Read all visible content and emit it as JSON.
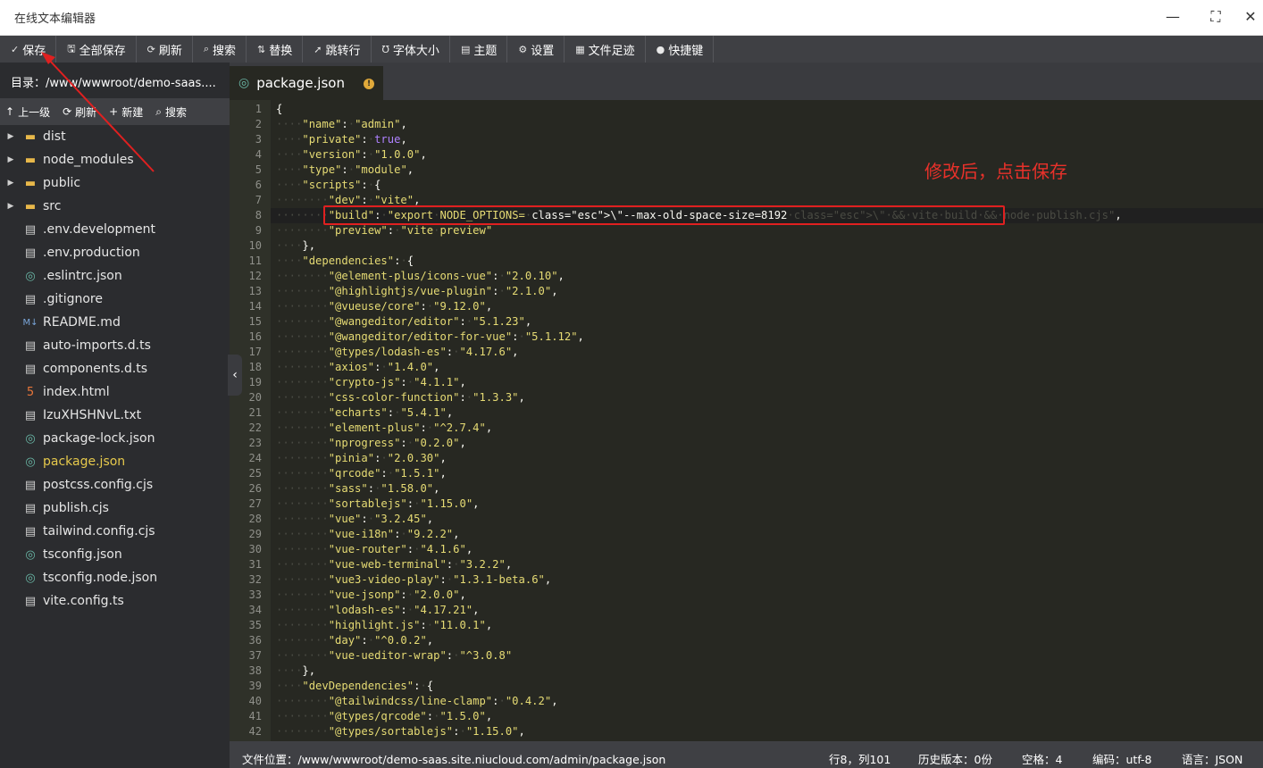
{
  "window": {
    "title": "在线文本编辑器",
    "minimize_icon": "minimize-icon",
    "maximize_icon": "maximize-icon",
    "close_icon": "close-icon"
  },
  "toolbar": {
    "items": [
      {
        "label": "保存",
        "icon": "✓",
        "name": "save"
      },
      {
        "label": "全部保存",
        "icon": "🖫",
        "name": "save-all"
      },
      {
        "label": "刷新",
        "icon": "⟳",
        "name": "refresh"
      },
      {
        "label": "搜索",
        "icon": "⌕",
        "name": "search"
      },
      {
        "label": "替换",
        "icon": "⇅",
        "name": "replace"
      },
      {
        "label": "跳转行",
        "icon": "➚",
        "name": "goto-line"
      },
      {
        "label": "字体大小",
        "icon": "Ʊ",
        "name": "font-size"
      },
      {
        "label": "主题",
        "icon": "▤",
        "name": "theme"
      },
      {
        "label": "设置",
        "icon": "⚙",
        "name": "settings"
      },
      {
        "label": "文件足迹",
        "icon": "▦",
        "name": "file-history"
      },
      {
        "label": "快捷键",
        "icon": "●",
        "name": "shortcuts"
      }
    ]
  },
  "sidebar": {
    "directory": "目录：/www/wwwroot/demo-saas....",
    "actions": [
      {
        "label": "上一级",
        "icon": "↑",
        "name": "parent"
      },
      {
        "label": "刷新",
        "icon": "⟳",
        "name": "refresh"
      },
      {
        "label": "新建",
        "icon": "+",
        "name": "new"
      },
      {
        "label": "搜索",
        "icon": "⌕",
        "name": "search"
      }
    ],
    "files": [
      {
        "label": "dist",
        "type": "folder"
      },
      {
        "label": "node_modules",
        "type": "folder"
      },
      {
        "label": "public",
        "type": "folder"
      },
      {
        "label": "src",
        "type": "folder"
      },
      {
        "label": ".env.development",
        "type": "file"
      },
      {
        "label": ".env.production",
        "type": "file"
      },
      {
        "label": ".eslintrc.json",
        "type": "json"
      },
      {
        "label": ".gitignore",
        "type": "file"
      },
      {
        "label": "README.md",
        "type": "md"
      },
      {
        "label": "auto-imports.d.ts",
        "type": "file"
      },
      {
        "label": "components.d.ts",
        "type": "file"
      },
      {
        "label": "index.html",
        "type": "html"
      },
      {
        "label": "IzuXHSHNvL.txt",
        "type": "file"
      },
      {
        "label": "package-lock.json",
        "type": "json"
      },
      {
        "label": "package.json",
        "type": "json",
        "active": true
      },
      {
        "label": "postcss.config.cjs",
        "type": "file"
      },
      {
        "label": "publish.cjs",
        "type": "file"
      },
      {
        "label": "tailwind.config.cjs",
        "type": "file"
      },
      {
        "label": "tsconfig.json",
        "type": "json"
      },
      {
        "label": "tsconfig.node.json",
        "type": "json"
      },
      {
        "label": "vite.config.ts",
        "type": "file"
      }
    ]
  },
  "tab": {
    "label": "package.json",
    "modified_badge": "!"
  },
  "editor": {
    "current_line": 8,
    "lines": [
      "{",
      "    \"name\": \"admin\",",
      "    \"private\": true,",
      "    \"version\": \"1.0.0\",",
      "    \"type\": \"module\",",
      "    \"scripts\": {",
      "        \"dev\": \"vite\",",
      "        \"build\": \"export NODE_OPTIONS=\\\"--max-old-space-size=8192\\\" && vite build && node publish.cjs\",",
      "        \"preview\": \"vite preview\"",
      "    },",
      "    \"dependencies\": {",
      "        \"@element-plus/icons-vue\": \"2.0.10\",",
      "        \"@highlightjs/vue-plugin\": \"2.1.0\",",
      "        \"@vueuse/core\": \"9.12.0\",",
      "        \"@wangeditor/editor\": \"5.1.23\",",
      "        \"@wangeditor/editor-for-vue\": \"5.1.12\",",
      "        \"@types/lodash-es\": \"4.17.6\",",
      "        \"axios\": \"1.4.0\",",
      "        \"crypto-js\": \"4.1.1\",",
      "        \"css-color-function\": \"1.3.3\",",
      "        \"echarts\": \"5.4.1\",",
      "        \"element-plus\": \"^2.7.4\",",
      "        \"nprogress\": \"0.2.0\",",
      "        \"pinia\": \"2.0.30\",",
      "        \"qrcode\": \"1.5.1\",",
      "        \"sass\": \"1.58.0\",",
      "        \"sortablejs\": \"1.15.0\",",
      "        \"vue\": \"3.2.45\",",
      "        \"vue-i18n\": \"9.2.2\",",
      "        \"vue-router\": \"4.1.6\",",
      "        \"vue-web-terminal\": \"3.2.2\",",
      "        \"vue3-video-play\": \"1.3.1-beta.6\",",
      "        \"vue-jsonp\": \"2.0.0\",",
      "        \"lodash-es\": \"4.17.21\",",
      "        \"highlight.js\": \"11.0.1\",",
      "        \"day\": \"^0.0.2\",",
      "        \"vue-ueditor-wrap\": \"^3.0.8\"",
      "    },",
      "    \"devDependencies\": {",
      "        \"@tailwindcss/line-clamp\": \"0.4.2\",",
      "        \"@types/qrcode\": \"1.5.0\",",
      "        \"@types/sortablejs\": \"1.15.0\","
    ]
  },
  "annotation": {
    "note": "修改后，点击保存"
  },
  "statusbar": {
    "file_path": "文件位置：/www/wwwroot/demo-saas.site.niucloud.com/admin/package.json",
    "position": "行8，列101",
    "history": "历史版本：0份",
    "indent": "空格：4",
    "encoding": "编码：utf-8",
    "language": "语言：JSON"
  },
  "colors": {
    "accent": "#e6c94c",
    "annotation": "#e02020"
  }
}
